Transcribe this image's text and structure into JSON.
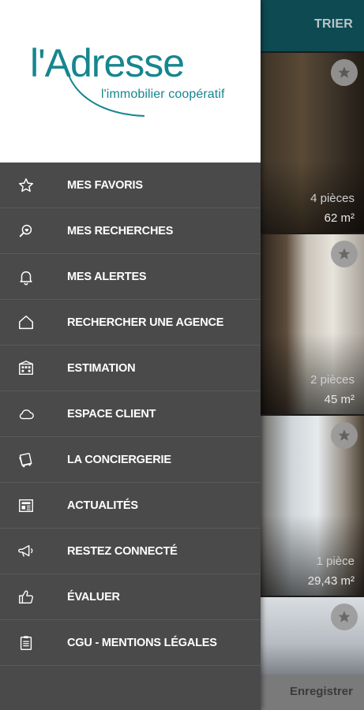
{
  "app": {
    "brand_name": "l'Adresse",
    "brand_tagline": "l'immobilier coopératif",
    "brand_color": "#15868e"
  },
  "toolbar": {
    "sort_label": "TRIER"
  },
  "listings": [
    {
      "rooms": "4 pièces",
      "area": "62 m²"
    },
    {
      "rooms": "2 pièces",
      "area": "45 m²"
    },
    {
      "rooms": "1 pièce",
      "area": "29,43 m²"
    },
    {
      "rooms": "",
      "area": ""
    }
  ],
  "footer": {
    "save_label": "Enregistrer"
  },
  "menu": {
    "items": [
      {
        "label": "MES FAVORIS",
        "icon": "star-outline-icon"
      },
      {
        "label": "MES RECHERCHES",
        "icon": "search-heart-icon"
      },
      {
        "label": "MES ALERTES",
        "icon": "bell-icon"
      },
      {
        "label": "RECHERCHER UNE AGENCE",
        "icon": "house-icon"
      },
      {
        "label": "ESTIMATION",
        "icon": "building-icon"
      },
      {
        "label": "ESPACE CLIENT",
        "icon": "cloud-icon"
      },
      {
        "label": "LA CONCIERGERIE",
        "icon": "concierge-icon"
      },
      {
        "label": "ACTUALITÉS",
        "icon": "newspaper-icon"
      },
      {
        "label": "RESTEZ CONNECTÉ",
        "icon": "megaphone-icon"
      },
      {
        "label": "ÉVALUER",
        "icon": "thumbs-up-icon"
      },
      {
        "label": "CGU - MENTIONS LÉGALES",
        "icon": "clipboard-icon"
      }
    ]
  }
}
